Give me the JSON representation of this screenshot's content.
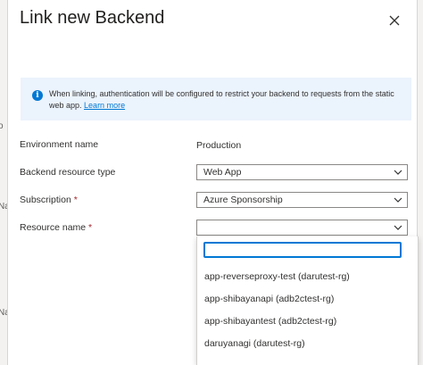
{
  "left_strip": {
    "fragments": [
      "o",
      "Na",
      "Na"
    ]
  },
  "panel": {
    "title": "Link new Backend",
    "close_icon": "close-icon"
  },
  "info": {
    "icon": "info-icon",
    "text": "When linking, authentication will be configured to restrict your backend to requests from the static web app.",
    "link": "Learn more"
  },
  "form": {
    "environment": {
      "label": "Environment name",
      "value": "Production"
    },
    "backend_type": {
      "label": "Backend resource type",
      "value": "Web App"
    },
    "subscription": {
      "label": "Subscription",
      "required": "*",
      "value": "Azure Sponsorship"
    },
    "resource_name": {
      "label": "Resource name",
      "required": "*",
      "value": ""
    }
  },
  "dropdown": {
    "search_value": "",
    "items": [
      "app-reverseproxy-test (darutest-rg)",
      "app-shibayanapi (adb2ctest-rg)",
      "app-shibayantest (adb2ctest-rg)",
      "daruyanagi (darutest-rg)"
    ]
  },
  "colors": {
    "accent": "#0078d4",
    "info_background": "#ebf3fc",
    "required": "#a4262c"
  }
}
